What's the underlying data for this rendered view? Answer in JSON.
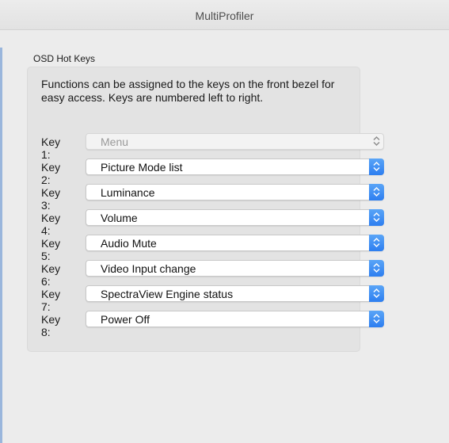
{
  "window": {
    "title": "MultiProfiler"
  },
  "section": {
    "label": "OSD Hot Keys",
    "description": "Functions can be assigned to the keys on the front bezel for easy access. Keys are numbered left to right."
  },
  "keys": [
    {
      "label": "Key 1:",
      "value": "Menu",
      "enabled": false
    },
    {
      "label": "Key 2:",
      "value": "Picture Mode list",
      "enabled": true
    },
    {
      "label": "Key 3:",
      "value": "Luminance",
      "enabled": true
    },
    {
      "label": "Key 4:",
      "value": "Volume",
      "enabled": true
    },
    {
      "label": "Key 5:",
      "value": "Audio Mute",
      "enabled": true
    },
    {
      "label": "Key 6:",
      "value": "Video Input change",
      "enabled": true
    },
    {
      "label": "Key 7:",
      "value": "SpectraView Engine status",
      "enabled": true
    },
    {
      "label": "Key 8:",
      "value": "Power Off",
      "enabled": true
    }
  ],
  "icons": {
    "stepper": "chevron-up-down-icon"
  },
  "colors": {
    "accent": "#2d7ef0",
    "window_bg": "#ececec",
    "group_bg": "#e3e3e3"
  }
}
